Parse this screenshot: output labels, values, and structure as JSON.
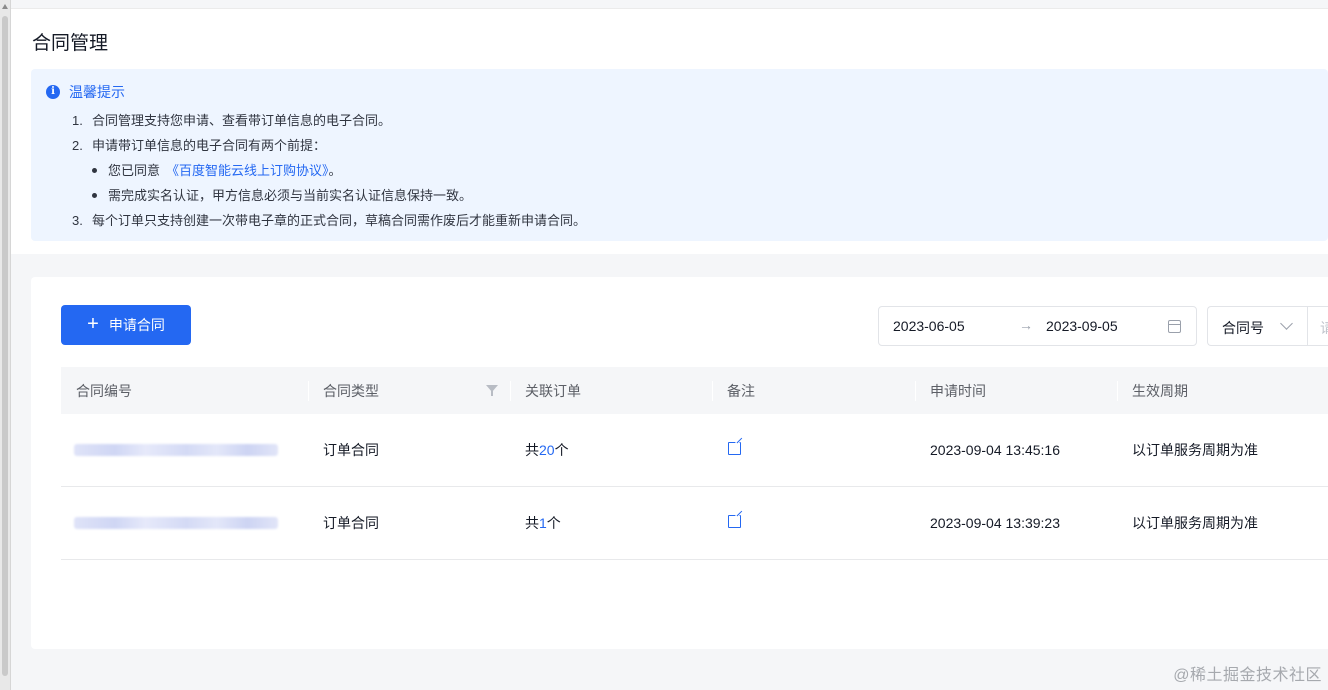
{
  "page": {
    "title": "合同管理"
  },
  "tips": {
    "title": "温馨提示",
    "items": [
      {
        "num": "1.",
        "text": "合同管理支持您申请、查看带订单信息的电子合同。"
      },
      {
        "num": "2.",
        "text": "申请带订单信息的电子合同有两个前提："
      },
      {
        "num": "3.",
        "text": "每个订单只支持创建一次带电子章的正式合同，草稿合同需作废后才能重新申请合同。"
      }
    ],
    "bullets": [
      {
        "prefix": "您已同意",
        "link": "《百度智能云线上订购协议》",
        "suffix": "。"
      },
      {
        "text": "需完成实名认证，甲方信息必须与当前实名认证信息保持一致。"
      }
    ]
  },
  "toolbar": {
    "apply_label": "申请合同",
    "plus_glyph": "+",
    "date_start": "2023-06-05",
    "date_sep": "→",
    "date_end": "2023-09-05",
    "select_label": "合同号",
    "search_stub": "请"
  },
  "table": {
    "columns": [
      "合同编号",
      "合同类型",
      "关联订单",
      "备注",
      "申请时间",
      "生效周期"
    ],
    "rows": [
      {
        "type": "订单合同",
        "order_prefix": "共",
        "order_count": "20",
        "order_suffix": "个",
        "apply_time": "2023-09-04 13:45:16",
        "period": "以订单服务周期为准"
      },
      {
        "type": "订单合同",
        "order_prefix": "共",
        "order_count": "1",
        "order_suffix": "个",
        "apply_time": "2023-09-04 13:39:23",
        "period": "以订单服务周期为准"
      }
    ]
  },
  "watermark": "@稀土掘金技术社区",
  "colors": {
    "primary": "#2468f2",
    "tips_bg": "#eef5ff",
    "table_header_bg": "#f5f6f8"
  },
  "icons": [
    "info-icon",
    "plus-icon",
    "calendar-icon",
    "chevron-down-icon",
    "filter-icon",
    "edit-icon"
  ]
}
